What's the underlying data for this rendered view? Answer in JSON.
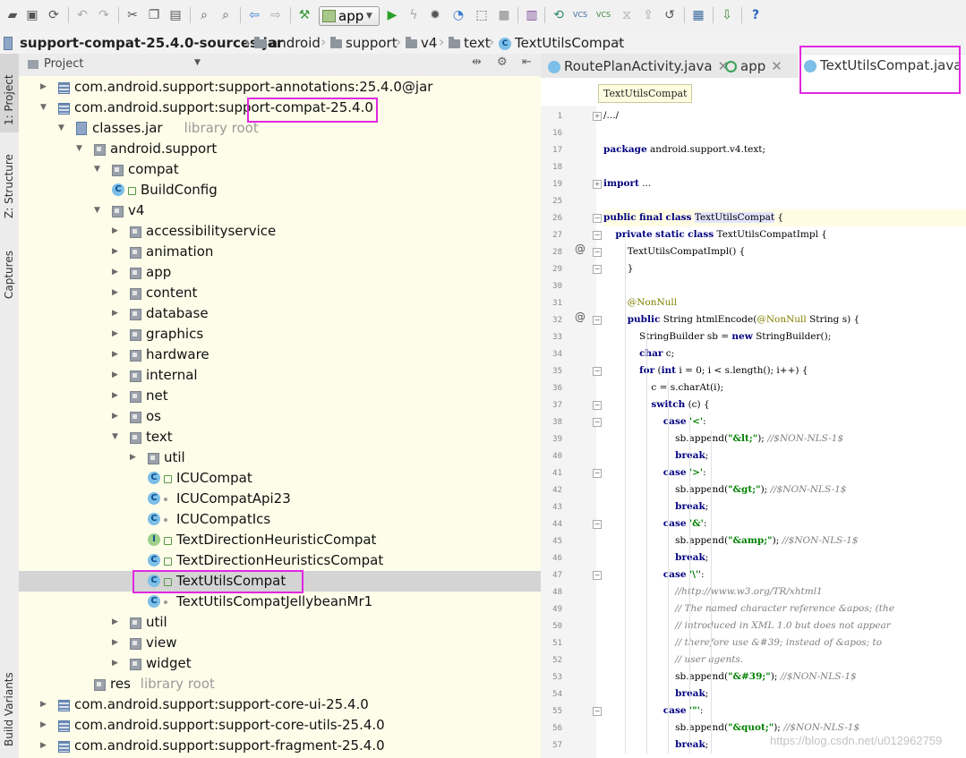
{
  "toolbar": {
    "run_config": "app"
  },
  "breadcrumb": {
    "items": [
      "support-compat-25.4.0-sources.jar",
      "android",
      "support",
      "v4",
      "text",
      "TextUtilsCompat"
    ]
  },
  "left_strip": {
    "project_tab": "1: Project",
    "structure_tab": "Z: Structure",
    "captures_tab": "Captures",
    "build_variants_tab": "Build Variants"
  },
  "project_panel": {
    "title": "Project"
  },
  "tree": {
    "rows": [
      {
        "label": "com.android.support:support-annotations:25.4.0@jar",
        "suffix": ""
      },
      {
        "label": "com.android.support:support-compat-25.4.0",
        "suffix": ""
      },
      {
        "label": "classes.jar",
        "suffix": "library root"
      },
      {
        "label": "android.support",
        "suffix": ""
      },
      {
        "label": "compat",
        "suffix": ""
      },
      {
        "label": "BuildConfig",
        "suffix": ""
      },
      {
        "label": "v4",
        "suffix": ""
      },
      {
        "label": "accessibilityservice",
        "suffix": ""
      },
      {
        "label": "animation",
        "suffix": ""
      },
      {
        "label": "app",
        "suffix": ""
      },
      {
        "label": "content",
        "suffix": ""
      },
      {
        "label": "database",
        "suffix": ""
      },
      {
        "label": "graphics",
        "suffix": ""
      },
      {
        "label": "hardware",
        "suffix": ""
      },
      {
        "label": "internal",
        "suffix": ""
      },
      {
        "label": "net",
        "suffix": ""
      },
      {
        "label": "os",
        "suffix": ""
      },
      {
        "label": "text",
        "suffix": ""
      },
      {
        "label": "util",
        "suffix": ""
      },
      {
        "label": "ICUCompat",
        "suffix": ""
      },
      {
        "label": "ICUCompatApi23",
        "suffix": ""
      },
      {
        "label": "ICUCompatIcs",
        "suffix": ""
      },
      {
        "label": "TextDirectionHeuristicCompat",
        "suffix": ""
      },
      {
        "label": "TextDirectionHeuristicsCompat",
        "suffix": ""
      },
      {
        "label": "TextUtilsCompat",
        "suffix": ""
      },
      {
        "label": "TextUtilsCompatJellybeanMr1",
        "suffix": ""
      },
      {
        "label": "util",
        "suffix": ""
      },
      {
        "label": "view",
        "suffix": ""
      },
      {
        "label": "widget",
        "suffix": ""
      },
      {
        "label": "res",
        "suffix": "library root"
      },
      {
        "label": "com.android.support:support-core-ui-25.4.0",
        "suffix": ""
      },
      {
        "label": "com.android.support:support-core-utils-25.4.0",
        "suffix": ""
      },
      {
        "label": "com.android.support:support-fragment-25.4.0",
        "suffix": ""
      }
    ]
  },
  "editor": {
    "tabs": [
      "RoutePlanActivity.java",
      "app",
      "TextUtilsCompat.java"
    ],
    "crumb_hint": "TextUtilsCompat",
    "line_numbers": [
      "1",
      "16",
      "17",
      "18",
      "19",
      "25",
      "26",
      "27",
      "28",
      "29",
      "30",
      "31",
      "32",
      "33",
      "34",
      "35",
      "36",
      "37",
      "38",
      "39",
      "40",
      "41",
      "42",
      "43",
      "44",
      "45",
      "46",
      "47",
      "48",
      "49",
      "50",
      "51",
      "52",
      "53",
      "54",
      "55",
      "56",
      "57"
    ],
    "lines": [
      "/.../",
      "",
      "package android.support.v4.text;",
      "",
      "import ...",
      "",
      "public final class TextUtilsCompat {",
      "    private static class TextUtilsCompatImpl {",
      "        TextUtilsCompatImpl() {",
      "        }",
      "",
      "        @NonNull",
      "        public String htmlEncode(@NonNull String s) {",
      "            StringBuilder sb = new StringBuilder();",
      "            char c;",
      "            for (int i = 0; i < s.length(); i++) {",
      "                c = s.charAt(i);",
      "                switch (c) {",
      "                    case '<':",
      "                        sb.append(\"&lt;\"); //$NON-NLS-1$",
      "                        break;",
      "                    case '>':",
      "                        sb.append(\"&gt;\"); //$NON-NLS-1$",
      "                        break;",
      "                    case '&':",
      "                        sb.append(\"&amp;\"); //$NON-NLS-1$",
      "                        break;",
      "                    case '\\'':",
      "                        //http://www.w3.org/TR/xhtml1",
      "                        // The named character reference &apos; (the",
      "                        // introduced in XML 1.0 but does not appear",
      "                        // therefore use &#39; instead of &apos; to",
      "                        // user agents.",
      "                        sb.append(\"&#39;\"); //$NON-NLS-1$",
      "                        break;",
      "                    case '\"':",
      "                        sb.append(\"&quot;\"); //$NON-NLS-1$",
      "                        break;"
    ],
    "watermark": "https://blog.csdn.net/u012962759"
  },
  "colors": {
    "tree_bg": "#fdfdea",
    "highlight_box": "#e028e0",
    "selection": "#d4d4d4"
  }
}
